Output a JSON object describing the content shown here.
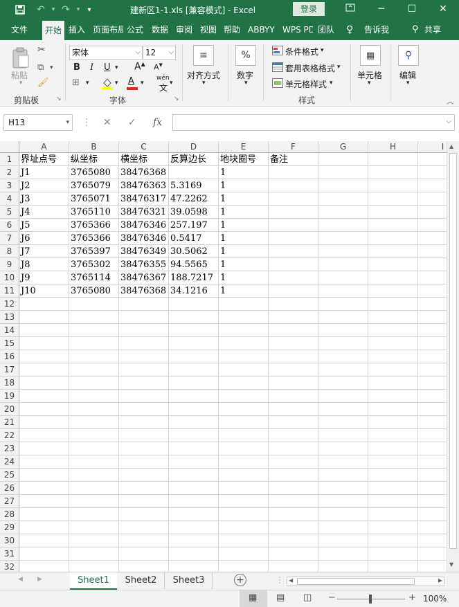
{
  "window": {
    "title": "建新区1-1.xls  [兼容模式]  -  Excel",
    "login_label": "登录"
  },
  "ribbon_tabs": [
    {
      "label": "文件",
      "active": false
    },
    {
      "label": "开始",
      "active": true
    },
    {
      "label": "插入",
      "active": false
    },
    {
      "label": "页面布局",
      "active": false
    },
    {
      "label": "公式",
      "active": false
    },
    {
      "label": "数据",
      "active": false
    },
    {
      "label": "审阅",
      "active": false
    },
    {
      "label": "视图",
      "active": false
    },
    {
      "label": "帮助",
      "active": false
    },
    {
      "label": "ABBYY",
      "active": false
    },
    {
      "label": "WPS PDF",
      "active": false
    },
    {
      "label": "团队",
      "active": false
    }
  ],
  "tell_me": "告诉我",
  "share": "共享",
  "ribbon": {
    "clipboard": {
      "paste": "粘贴",
      "group": "剪贴板"
    },
    "font": {
      "name": "宋体",
      "size": "12",
      "bold": "B",
      "italic": "I",
      "underline": "U",
      "grow": "A",
      "shrink": "A",
      "color_a": "A",
      "phonetic": "wén",
      "group": "字体"
    },
    "alignment": {
      "label": "对齐方式"
    },
    "number": {
      "label": "数字",
      "icon": "%"
    },
    "styles": {
      "conditional": "条件格式",
      "table": "套用表格格式",
      "cell": "单元格样式",
      "group": "样式"
    },
    "cells": {
      "label": "单元格"
    },
    "editing": {
      "label": "编辑"
    }
  },
  "formula_bar": {
    "name_box": "H13",
    "fx": "fx",
    "value": ""
  },
  "columns": [
    "A",
    "B",
    "C",
    "D",
    "E",
    "F",
    "G",
    "H",
    "I"
  ],
  "rows": [
    "1",
    "2",
    "3",
    "4",
    "5",
    "6",
    "7",
    "8",
    "9",
    "10",
    "11",
    "12",
    "13",
    "14",
    "15",
    "16",
    "17",
    "18",
    "19",
    "20",
    "21",
    "22",
    "23",
    "24",
    "25",
    "26",
    "27",
    "28",
    "29",
    "30",
    "31",
    "32"
  ],
  "table": [
    [
      "界址点号",
      "纵坐标",
      "横坐标",
      "反算边长",
      "地块圈号",
      "备注"
    ],
    [
      "J1",
      "3765080",
      "38476368",
      "",
      "1",
      ""
    ],
    [
      "J2",
      "3765079",
      "38476363",
      "5.3169",
      "1",
      ""
    ],
    [
      "J3",
      "3765071",
      "38476317",
      "47.2262",
      "1",
      ""
    ],
    [
      "J4",
      "3765110",
      "38476321",
      "39.0598",
      "1",
      ""
    ],
    [
      "J5",
      "3765366",
      "38476346",
      "257.197",
      "1",
      ""
    ],
    [
      "J6",
      "3765366",
      "38476346",
      "0.5417",
      "1",
      ""
    ],
    [
      "J7",
      "3765397",
      "38476349",
      "30.5062",
      "1",
      ""
    ],
    [
      "J8",
      "3765302",
      "38476355",
      "94.5565",
      "1",
      ""
    ],
    [
      "J9",
      "3765114",
      "38476367",
      "188.7217",
      "1",
      ""
    ],
    [
      "J10",
      "3765080",
      "38476368",
      "34.1216",
      "1",
      ""
    ]
  ],
  "sheets": [
    {
      "label": "Sheet1",
      "active": true
    },
    {
      "label": "Sheet2",
      "active": false
    },
    {
      "label": "Sheet3",
      "active": false
    }
  ],
  "status": {
    "zoom": "100%",
    "minus": "−",
    "plus": "+"
  }
}
